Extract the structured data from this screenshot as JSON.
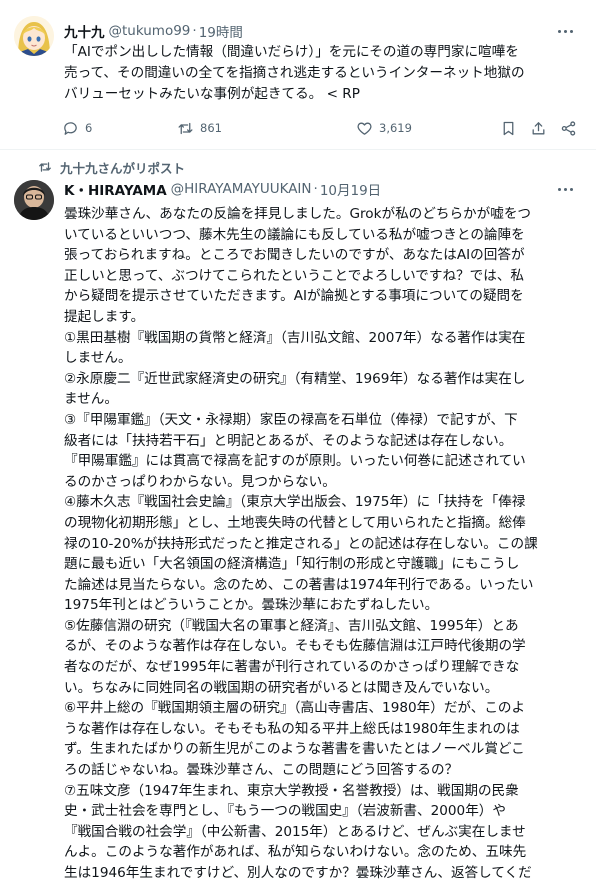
{
  "post1": {
    "display_name": "九十九",
    "handle": "@tukumo99",
    "separator": "·",
    "time": "19時間",
    "text_lines": [
      "「AIでポン出しした情報（間違いだらけ）」を元にその道の専門家に喧嘩を",
      "売って、その間違いの全てを指摘され逃走するというインターネット地獄の",
      "バリューセットみたいな事例が起きてる。 < RP"
    ],
    "reply_count": "6",
    "repost_count": "861",
    "like_count": "3,619"
  },
  "repost_notice": "九十九さんがリポスト",
  "post2": {
    "display_name": "K・HIRAYAMA",
    "handle": "@HIRAYAMAYUUKAIN",
    "separator": "·",
    "time": "10月19日",
    "text_lines": [
      "曇珠沙華さん、あなたの反論を拝見しました。Grokが私のどちらかが嘘をつ",
      "いているといいつつ、藤木先生の議論にも反している私が嘘つきとの論陣を",
      "張っておられますね。ところでお聞きしたいのですが、あなたはAIの回答が",
      "正しいと思って、ぶつけてこられたということでよろしいですね？では、私",
      "から疑問を提示させていただきます。AIが論拠とする事項についての疑問を",
      "提起します。",
      "①黒田基樹『戦国期の貨幣と経済』（吉川弘文館、2007年）なる著作は実在",
      "しません。",
      "②永原慶二『近世武家経済史の研究』（有精堂、1969年）なる著作は実在し",
      "ません。",
      "③『甲陽軍鑑』（天文・永禄期）家臣の禄高を石単位（俸禄）で記すが、下",
      "級者には「扶持若干石」と明記とあるが、そのような記述は存在しない。",
      "『甲陽軍鑑』には貫高で禄高を記すのが原則。いったい何巻に記述されてい",
      "るのかさっぱりわからない。見つからない。",
      "④藤木久志『戦国社会史論』（東京大学出版会、1975年）に「扶持を「俸禄",
      "の現物化初期形態」とし、土地喪失時の代替として用いられたと指摘。総俸",
      "禄の10-20%が扶持形式だったと推定される」との記述は存在しない。この課",
      "題に最も近い「大名領国の経済構造」「知行制の形成と守護職」にもこうし",
      "た論述は見当たらない。念のため、この著書は1974年刊行である。いったい",
      "1975年刊とはどういうことか。曇珠沙華におたずねしたい。",
      "⑤佐藤信淵の研究（『戦国大名の軍事と経済』、吉川弘文館、1995年）とあ",
      "るが、そのような著作は存在しない。そもそも佐藤信淵は江戸時代後期の学",
      "者なのだが、なぜ1995年に著書が刊行されているのかさっぱり理解できな",
      "い。ちなみに同姓同名の戦国期の研究者がいるとは聞き及んでいない。",
      "⑥平井上総の『戦国期領主層の研究』（高山寺書店、1980年）だが、このよ",
      "うな著作は存在しない。そもそも私の知る平井上総氏は1980年生まれのは",
      "ず。生まれたばかりの新生児がこのような著書を書いたとはノーベル賞どこ",
      "ろの話じゃないね。曇珠沙華さん、この問題にどう回答するの？",
      "⑦五味文彦（1947年生まれ、東京大学教授・名誉教授）は、戦国期の民衆",
      "史・武士社会を専門とし、『もう一つの戦国史』（岩波新書、2000年）や",
      "『戦国合戦の社会学』（中公新書、2015年）とあるけど、ぜんぶ実在しませ",
      "んよ。このような著作があれば、私が知らないわけない。念のため、五味先",
      "生は1946年生まれですけど、別人なのですか？曇珠沙華さん、返答してくだ"
    ]
  }
}
